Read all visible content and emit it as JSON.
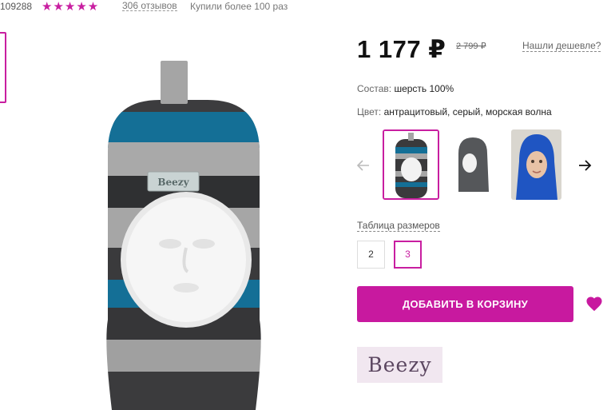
{
  "header": {
    "sku": "109288",
    "rating_stars": "★★★★★",
    "reviews": "306 отзывов",
    "bought": "Купили более 100 раз"
  },
  "product": {
    "price": "1 177 ₽",
    "old_price": "2 799 ₽",
    "cheaper_link": "Нашли дешевле?",
    "composition_label": "Состав:",
    "composition_value": "шерсть 100%",
    "color_label": "Цвет:",
    "color_value": "антрацитовый, серый, морская волна",
    "hat_logo": "Beezy"
  },
  "color_options": {
    "selected_index": 0,
    "count": 3
  },
  "sizes": {
    "table_link": "Таблица размеров",
    "options": [
      "2",
      "3"
    ],
    "selected": "3"
  },
  "actions": {
    "add_to_cart": "ДОБАВИТЬ В КОРЗИНУ"
  },
  "brand": {
    "name": "Beezy"
  },
  "colors": {
    "accent": "#c8199f",
    "price_text": "#111111",
    "brand_bg": "#f1e7f0"
  }
}
